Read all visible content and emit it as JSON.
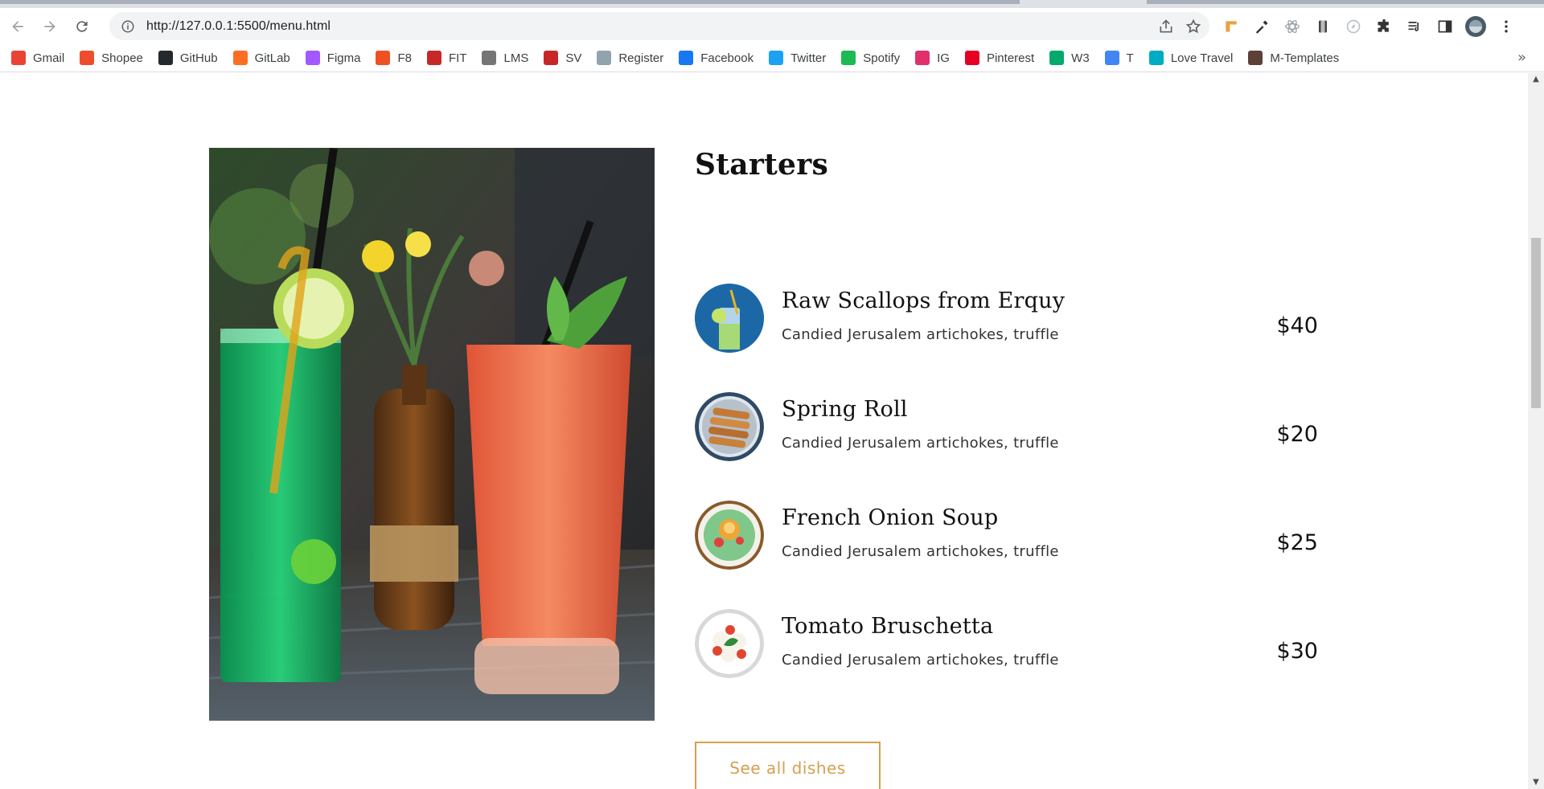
{
  "browser": {
    "url": "http://127.0.0.1:5500/menu.html",
    "bookmarks": [
      {
        "label": "Gmail",
        "icon": "gmail-icon",
        "color": "#ea4335"
      },
      {
        "label": "Shopee",
        "icon": "shopee-icon",
        "color": "#ee4d2d"
      },
      {
        "label": "GitHub",
        "icon": "github-icon",
        "color": "#24292e"
      },
      {
        "label": "GitLab",
        "icon": "gitlab-icon",
        "color": "#fc6d26"
      },
      {
        "label": "Figma",
        "icon": "figma-icon",
        "color": "#a259ff"
      },
      {
        "label": "F8",
        "icon": "f8-icon",
        "color": "#f05123"
      },
      {
        "label": "FIT",
        "icon": "fit-icon",
        "color": "#c62828"
      },
      {
        "label": "LMS",
        "icon": "lms-icon",
        "color": "#757575"
      },
      {
        "label": "SV",
        "icon": "sv-icon",
        "color": "#c62828"
      },
      {
        "label": "Register",
        "icon": "register-icon",
        "color": "#90a4ae"
      },
      {
        "label": "Facebook",
        "icon": "facebook-icon",
        "color": "#1877f2"
      },
      {
        "label": "Twitter",
        "icon": "twitter-icon",
        "color": "#1da1f2"
      },
      {
        "label": "Spotify",
        "icon": "spotify-icon",
        "color": "#1db954"
      },
      {
        "label": "IG",
        "icon": "instagram-icon",
        "color": "#e1306c"
      },
      {
        "label": "Pinterest",
        "icon": "pinterest-icon",
        "color": "#e60023"
      },
      {
        "label": "W3",
        "icon": "w3-icon",
        "color": "#04aa6d"
      },
      {
        "label": "T",
        "icon": "translate-icon",
        "color": "#4285f4"
      },
      {
        "label": "Love Travel",
        "icon": "love-travel-icon",
        "color": "#00acc1"
      },
      {
        "label": "M-Templates",
        "icon": "m-templates-icon",
        "color": "#5d4037"
      }
    ],
    "more_bookmarks": "»"
  },
  "menu": {
    "section_title": "Starters",
    "dishes": [
      {
        "name": "Raw Scallops from Erquy",
        "description": "Candied Jerusalem artichokes, truffle",
        "price": "$40",
        "image": "mojito-drink"
      },
      {
        "name": "Spring Roll",
        "description": "Candied Jerusalem artichokes, truffle",
        "price": "$20",
        "image": "spring-rolls"
      },
      {
        "name": "French Onion Soup",
        "description": "Candied Jerusalem artichokes, truffle",
        "price": "$25",
        "image": "salad-plate"
      },
      {
        "name": "Tomato Bruschetta",
        "description": "Candied Jerusalem artichokes, truffle",
        "price": "$30",
        "image": "caprese-plate"
      }
    ],
    "cta_label": "See all dishes"
  },
  "colors": {
    "accent": "#d6a04f",
    "text": "#111111"
  }
}
